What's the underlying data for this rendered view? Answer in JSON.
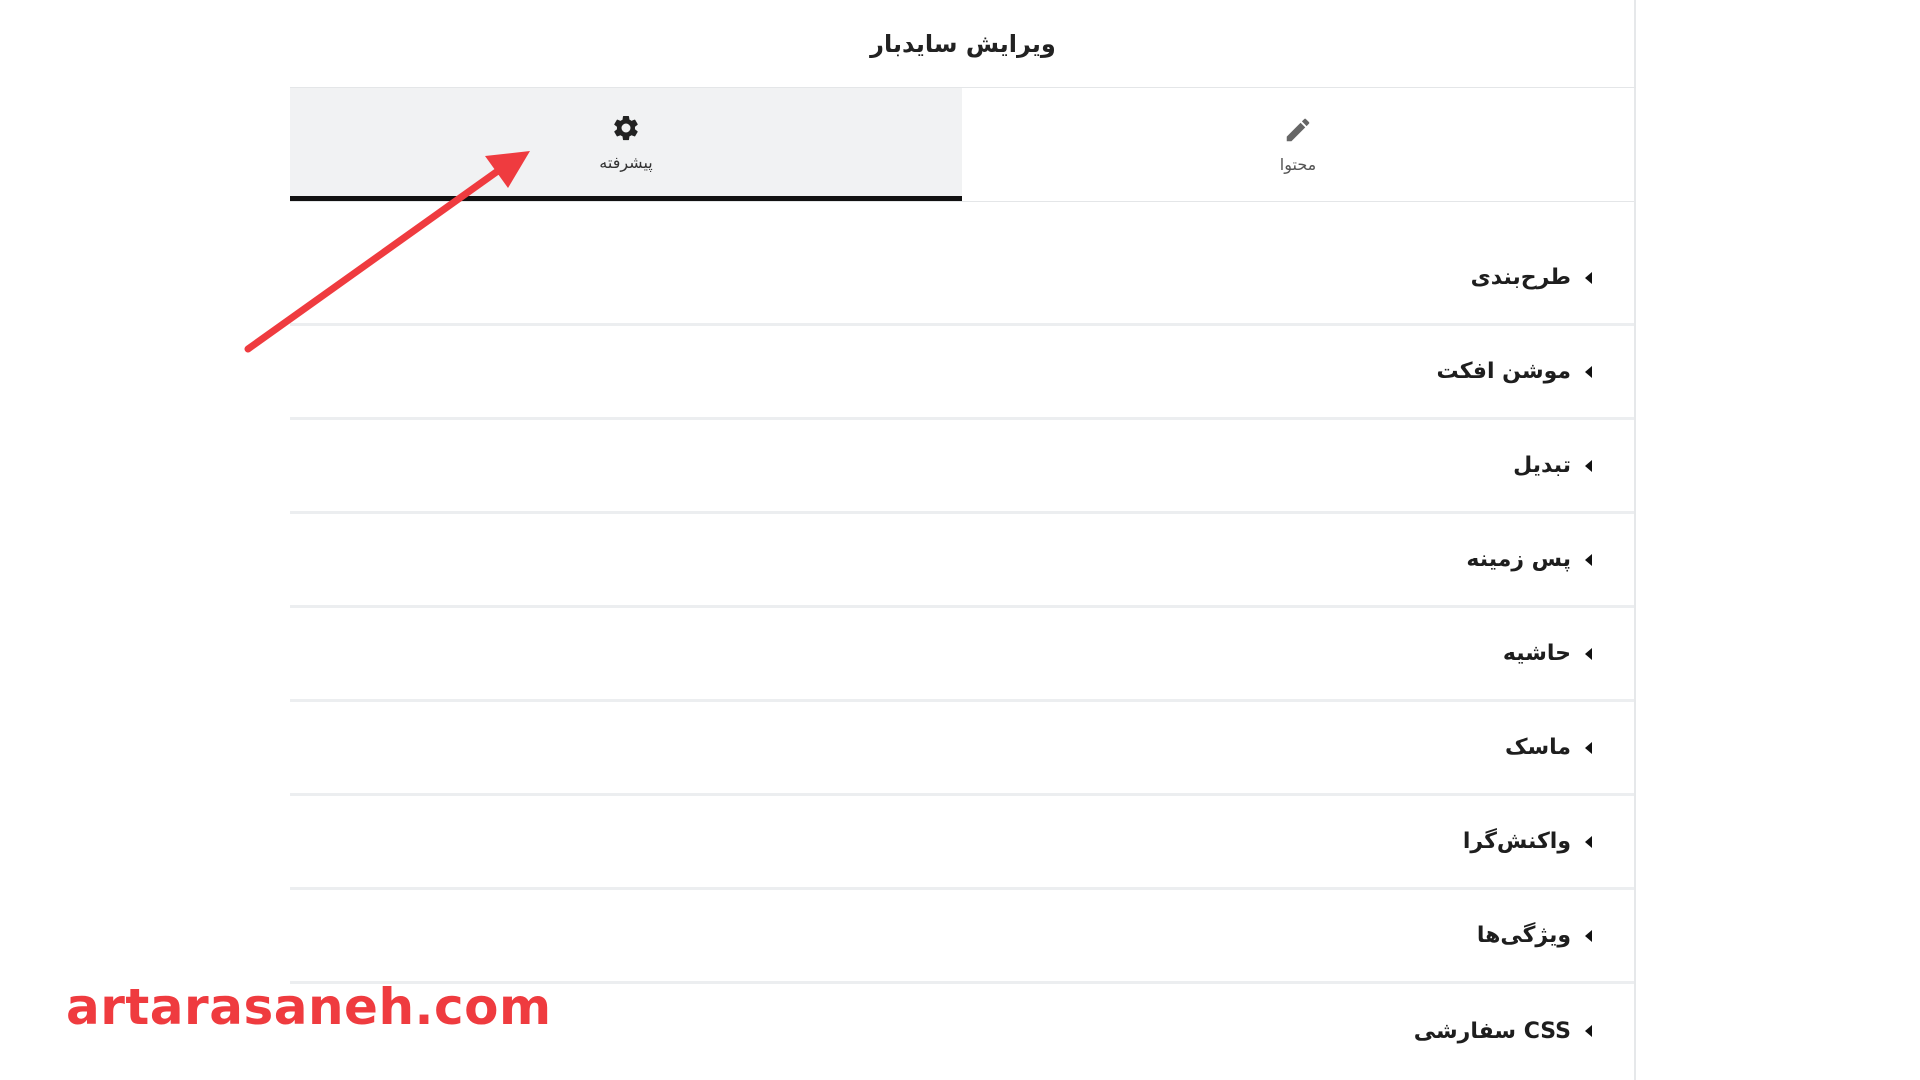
{
  "panel": {
    "title": "ویرایش سایدبار"
  },
  "tabs": [
    {
      "label": "پیشرفته",
      "icon": "gear-icon",
      "active": true
    },
    {
      "label": "محتوا",
      "icon": "pencil-icon",
      "active": false
    }
  ],
  "sections": [
    {
      "label": "طرح‌بندی"
    },
    {
      "label": "موشن افکت"
    },
    {
      "label": "تبدیل"
    },
    {
      "label": "پس زمینه"
    },
    {
      "label": "حاشیه"
    },
    {
      "label": "ماسک"
    },
    {
      "label": "واکنش‌گرا"
    },
    {
      "label": "ویژگی‌ها"
    },
    {
      "label": "CSS سفارشی"
    }
  ],
  "watermark": "artarasaneh.com",
  "colors": {
    "annotation_arrow": "#ef3b3f",
    "active_tab_bg": "#f1f2f3",
    "active_tab_underline": "#111111"
  }
}
